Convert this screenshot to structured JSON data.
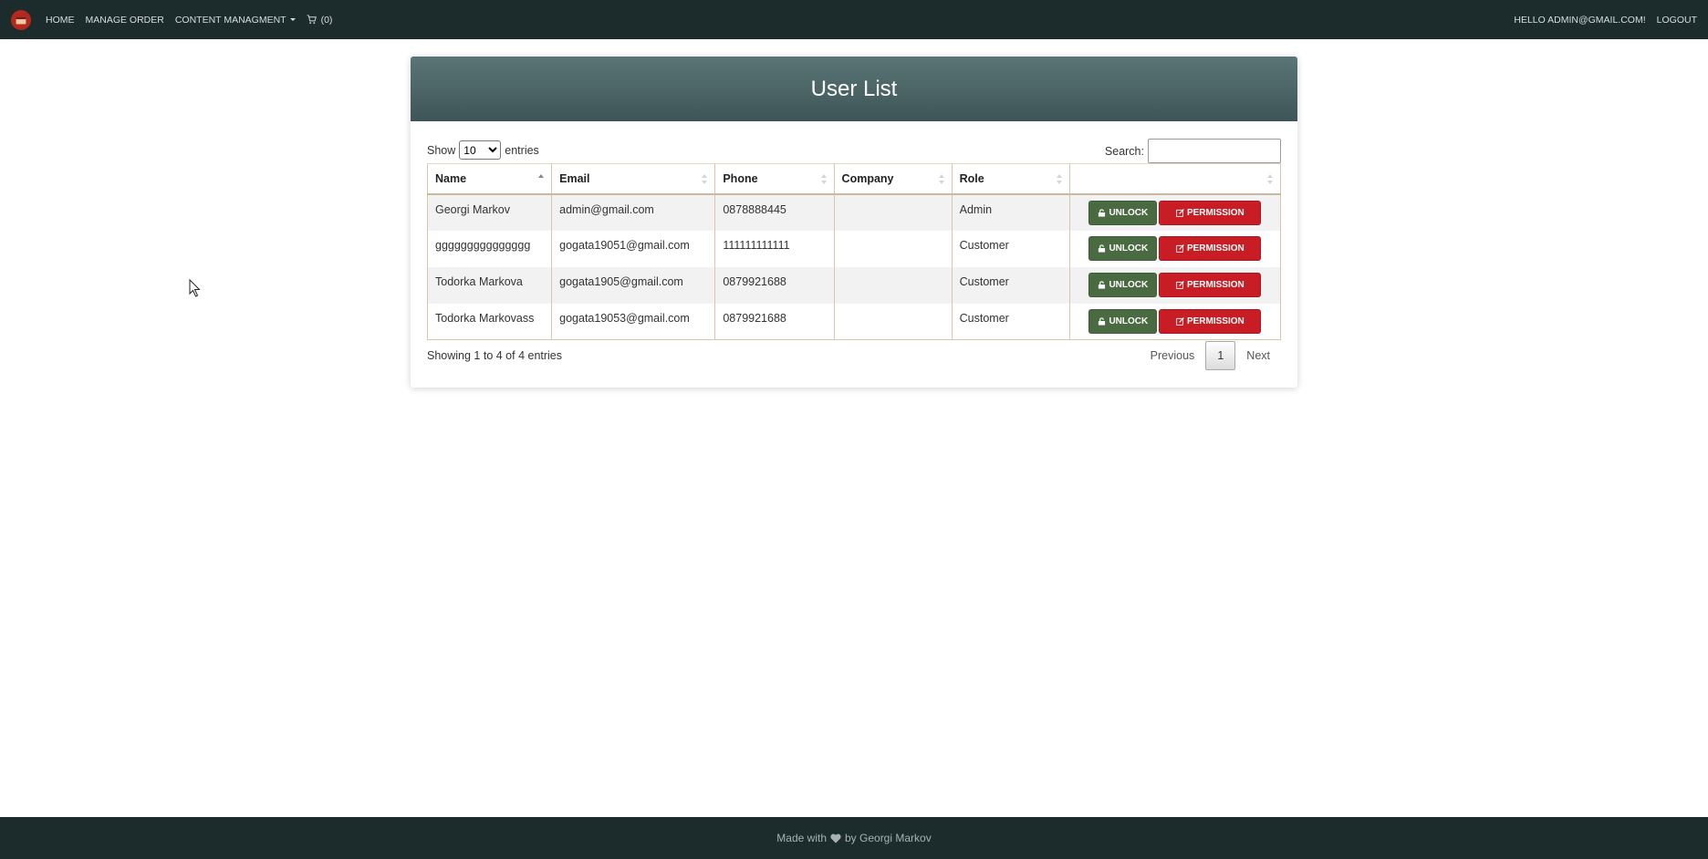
{
  "navbar": {
    "links": [
      "HOME",
      "MANAGE ORDER",
      "CONTENT MANAGMENT"
    ],
    "cart_count": "(0)",
    "greeting": "HELLO ADMIN@GMAIL.COM!",
    "logout": "LOGOUT"
  },
  "panel": {
    "title": "User List",
    "show_label": "Show",
    "entries_label": "entries",
    "page_length": "10",
    "search_label": "Search:",
    "search_value": ""
  },
  "table": {
    "columns": [
      "Name",
      "Email",
      "Phone",
      "Company",
      "Role",
      ""
    ],
    "rows": [
      {
        "name": "Georgi Markov",
        "email": "admin@gmail.com",
        "phone": "0878888445",
        "company": "",
        "role": "Admin"
      },
      {
        "name": "ggggggggggggggg",
        "email": "gogata19051@gmail.com",
        "phone": "111111111111",
        "company": "",
        "role": "Customer"
      },
      {
        "name": "Todorka Markova",
        "email": "gogata1905@gmail.com",
        "phone": "0879921688",
        "company": "",
        "role": "Customer"
      },
      {
        "name": "Todorka Markovass",
        "email": "gogata19053@gmail.com",
        "phone": "0879921688",
        "company": "",
        "role": "Customer"
      }
    ],
    "unlock_label": "UNLOCK",
    "permission_label": "PERMISSION"
  },
  "pagination": {
    "info": "Showing 1 to 4 of 4 entries",
    "previous": "Previous",
    "current_page": "1",
    "next": "Next"
  },
  "footer": {
    "made_with": "Made with",
    "by": "by Georgi Markov"
  },
  "colors": {
    "navbar_bg": "#1c2b2b",
    "header_bg": "#4b6466",
    "unlock_bg": "#4a6b41",
    "permission_bg": "#c81d25"
  }
}
